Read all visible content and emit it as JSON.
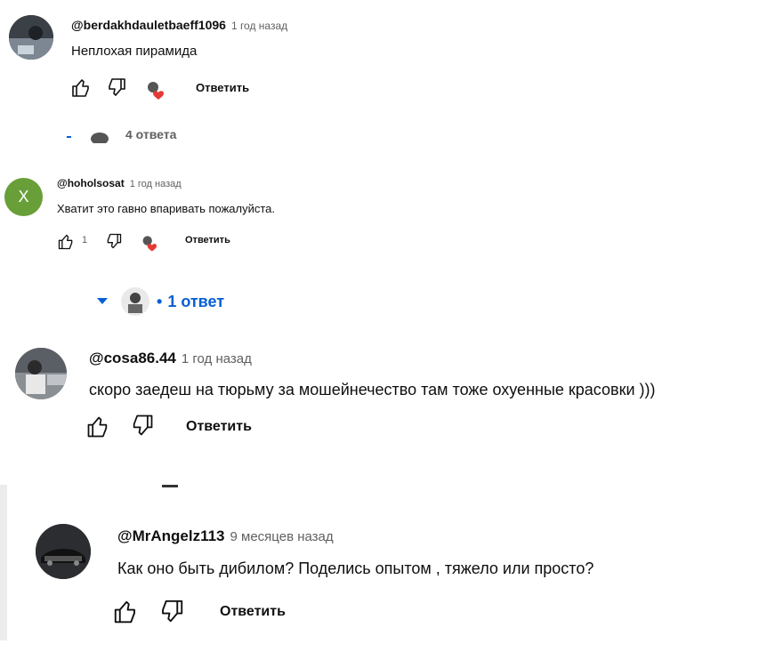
{
  "comments": [
    {
      "handle": "@berdakhdauletbaeff1096",
      "time": "1 год назад",
      "text": "Неплохая пирамида",
      "reply": "Ответить",
      "likes": ""
    },
    {
      "handle": "@hoholsosat",
      "time": "1 год назад",
      "text": "Хватит это гавно впаривать пожалуйста.",
      "reply": "Ответить",
      "likes": "1",
      "avatar_letter": "X",
      "avatar_color": "#689f38"
    },
    {
      "handle": "@cosa86.44",
      "time": "1 год назад",
      "text": "скоро заедеш на тюрьму за мошейнечество там тоже охуенные красовки )))",
      "reply": "Ответить",
      "likes": ""
    },
    {
      "handle": "@MrAngelz113",
      "time": "9 месяцев назад",
      "text": "Как оно быть дибилом? Поделись опытом , тяжело или просто?",
      "reply": "Ответить",
      "likes": ""
    }
  ],
  "replies_partial": "4 ответа",
  "replies_link": {
    "separator": "•",
    "label": "1 ответ"
  },
  "colors": {
    "link": "#065fd4",
    "heart": "#e53935",
    "secondary": "#606060"
  }
}
